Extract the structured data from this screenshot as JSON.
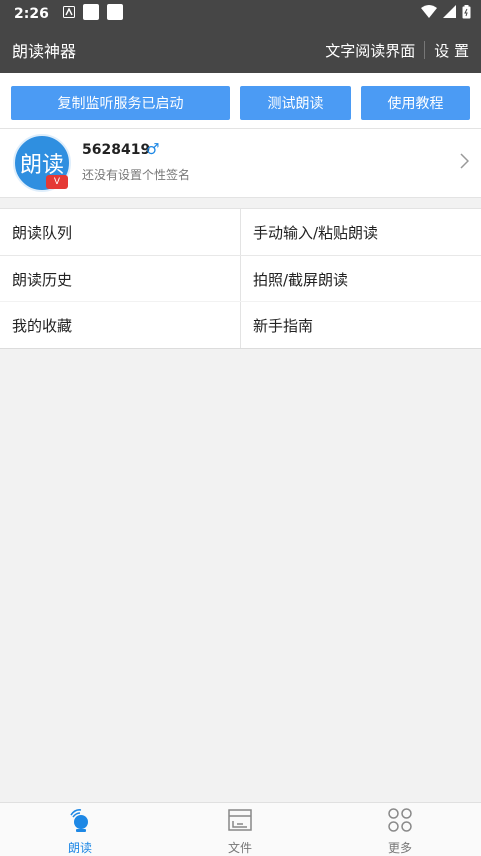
{
  "status_bar": {
    "time": "2:26"
  },
  "app_bar": {
    "title": "朗读神器",
    "text_read_label": "文字阅读界面",
    "settings_label": "设 置"
  },
  "action_buttons": {
    "copy_monitor_label": "复制监听服务已启动",
    "test_read_label": "测试朗读",
    "tutorial_label": "使用教程"
  },
  "profile": {
    "avatar_text": "朗读",
    "badge_text": "V",
    "username": "5628419",
    "gender_symbol": "♂",
    "signature": "还没有设置个性签名"
  },
  "menu": {
    "items": [
      "朗读队列",
      "手动输入/粘贴朗读",
      "朗读历史",
      "拍照/截屏朗读",
      "我的收藏",
      "新手指南"
    ]
  },
  "bottom_nav": {
    "items": [
      {
        "label": "朗读",
        "icon": "read-aloud-icon",
        "active": true
      },
      {
        "label": "文件",
        "icon": "file-icon",
        "active": false
      },
      {
        "label": "更多",
        "icon": "more-grid-icon",
        "active": false
      }
    ]
  },
  "colors": {
    "bar_bg": "#464646",
    "accent": "#4b9bf4",
    "active_nav": "#1e88e5"
  }
}
